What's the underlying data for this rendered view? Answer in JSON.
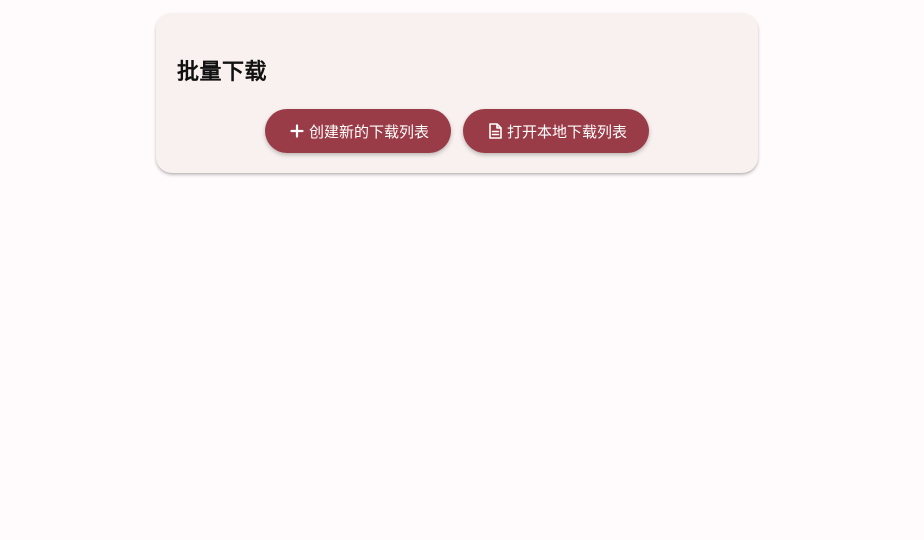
{
  "batch_download": {
    "title": "批量下载",
    "create_button": {
      "label": "创建新的下载列表",
      "icon": "plus-icon"
    },
    "open_button": {
      "label": "打开本地下载列表",
      "icon": "file-document-icon"
    }
  },
  "colors": {
    "page_background": "#fffbfc",
    "card_background": "#f8f1ef",
    "button_background": "#9a3c47",
    "button_text": "#ffffff",
    "title_text": "#111111"
  }
}
